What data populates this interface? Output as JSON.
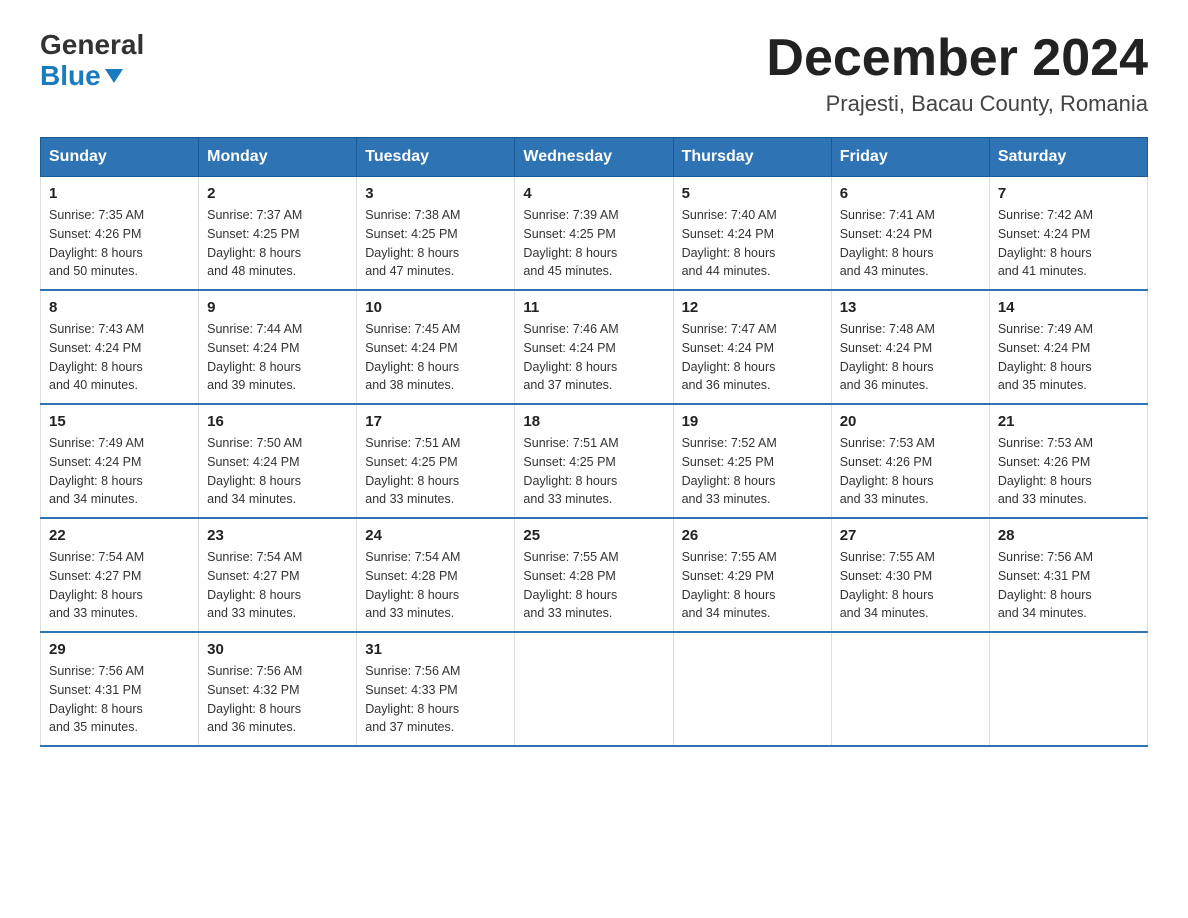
{
  "logo": {
    "general": "General",
    "blue": "Blue"
  },
  "title": "December 2024",
  "subtitle": "Prajesti, Bacau County, Romania",
  "days_of_week": [
    "Sunday",
    "Monday",
    "Tuesday",
    "Wednesday",
    "Thursday",
    "Friday",
    "Saturday"
  ],
  "weeks": [
    [
      {
        "day": "1",
        "sunrise": "7:35 AM",
        "sunset": "4:26 PM",
        "daylight": "8 hours and 50 minutes."
      },
      {
        "day": "2",
        "sunrise": "7:37 AM",
        "sunset": "4:25 PM",
        "daylight": "8 hours and 48 minutes."
      },
      {
        "day": "3",
        "sunrise": "7:38 AM",
        "sunset": "4:25 PM",
        "daylight": "8 hours and 47 minutes."
      },
      {
        "day": "4",
        "sunrise": "7:39 AM",
        "sunset": "4:25 PM",
        "daylight": "8 hours and 45 minutes."
      },
      {
        "day": "5",
        "sunrise": "7:40 AM",
        "sunset": "4:24 PM",
        "daylight": "8 hours and 44 minutes."
      },
      {
        "day": "6",
        "sunrise": "7:41 AM",
        "sunset": "4:24 PM",
        "daylight": "8 hours and 43 minutes."
      },
      {
        "day": "7",
        "sunrise": "7:42 AM",
        "sunset": "4:24 PM",
        "daylight": "8 hours and 41 minutes."
      }
    ],
    [
      {
        "day": "8",
        "sunrise": "7:43 AM",
        "sunset": "4:24 PM",
        "daylight": "8 hours and 40 minutes."
      },
      {
        "day": "9",
        "sunrise": "7:44 AM",
        "sunset": "4:24 PM",
        "daylight": "8 hours and 39 minutes."
      },
      {
        "day": "10",
        "sunrise": "7:45 AM",
        "sunset": "4:24 PM",
        "daylight": "8 hours and 38 minutes."
      },
      {
        "day": "11",
        "sunrise": "7:46 AM",
        "sunset": "4:24 PM",
        "daylight": "8 hours and 37 minutes."
      },
      {
        "day": "12",
        "sunrise": "7:47 AM",
        "sunset": "4:24 PM",
        "daylight": "8 hours and 36 minutes."
      },
      {
        "day": "13",
        "sunrise": "7:48 AM",
        "sunset": "4:24 PM",
        "daylight": "8 hours and 36 minutes."
      },
      {
        "day": "14",
        "sunrise": "7:49 AM",
        "sunset": "4:24 PM",
        "daylight": "8 hours and 35 minutes."
      }
    ],
    [
      {
        "day": "15",
        "sunrise": "7:49 AM",
        "sunset": "4:24 PM",
        "daylight": "8 hours and 34 minutes."
      },
      {
        "day": "16",
        "sunrise": "7:50 AM",
        "sunset": "4:24 PM",
        "daylight": "8 hours and 34 minutes."
      },
      {
        "day": "17",
        "sunrise": "7:51 AM",
        "sunset": "4:25 PM",
        "daylight": "8 hours and 33 minutes."
      },
      {
        "day": "18",
        "sunrise": "7:51 AM",
        "sunset": "4:25 PM",
        "daylight": "8 hours and 33 minutes."
      },
      {
        "day": "19",
        "sunrise": "7:52 AM",
        "sunset": "4:25 PM",
        "daylight": "8 hours and 33 minutes."
      },
      {
        "day": "20",
        "sunrise": "7:53 AM",
        "sunset": "4:26 PM",
        "daylight": "8 hours and 33 minutes."
      },
      {
        "day": "21",
        "sunrise": "7:53 AM",
        "sunset": "4:26 PM",
        "daylight": "8 hours and 33 minutes."
      }
    ],
    [
      {
        "day": "22",
        "sunrise": "7:54 AM",
        "sunset": "4:27 PM",
        "daylight": "8 hours and 33 minutes."
      },
      {
        "day": "23",
        "sunrise": "7:54 AM",
        "sunset": "4:27 PM",
        "daylight": "8 hours and 33 minutes."
      },
      {
        "day": "24",
        "sunrise": "7:54 AM",
        "sunset": "4:28 PM",
        "daylight": "8 hours and 33 minutes."
      },
      {
        "day": "25",
        "sunrise": "7:55 AM",
        "sunset": "4:28 PM",
        "daylight": "8 hours and 33 minutes."
      },
      {
        "day": "26",
        "sunrise": "7:55 AM",
        "sunset": "4:29 PM",
        "daylight": "8 hours and 34 minutes."
      },
      {
        "day": "27",
        "sunrise": "7:55 AM",
        "sunset": "4:30 PM",
        "daylight": "8 hours and 34 minutes."
      },
      {
        "day": "28",
        "sunrise": "7:56 AM",
        "sunset": "4:31 PM",
        "daylight": "8 hours and 34 minutes."
      }
    ],
    [
      {
        "day": "29",
        "sunrise": "7:56 AM",
        "sunset": "4:31 PM",
        "daylight": "8 hours and 35 minutes."
      },
      {
        "day": "30",
        "sunrise": "7:56 AM",
        "sunset": "4:32 PM",
        "daylight": "8 hours and 36 minutes."
      },
      {
        "day": "31",
        "sunrise": "7:56 AM",
        "sunset": "4:33 PM",
        "daylight": "8 hours and 37 minutes."
      },
      null,
      null,
      null,
      null
    ]
  ],
  "labels": {
    "sunrise": "Sunrise:",
    "sunset": "Sunset:",
    "daylight": "Daylight:"
  },
  "colors": {
    "header_bg": "#2e74b5",
    "header_text": "#ffffff",
    "border": "#2e74b5"
  }
}
